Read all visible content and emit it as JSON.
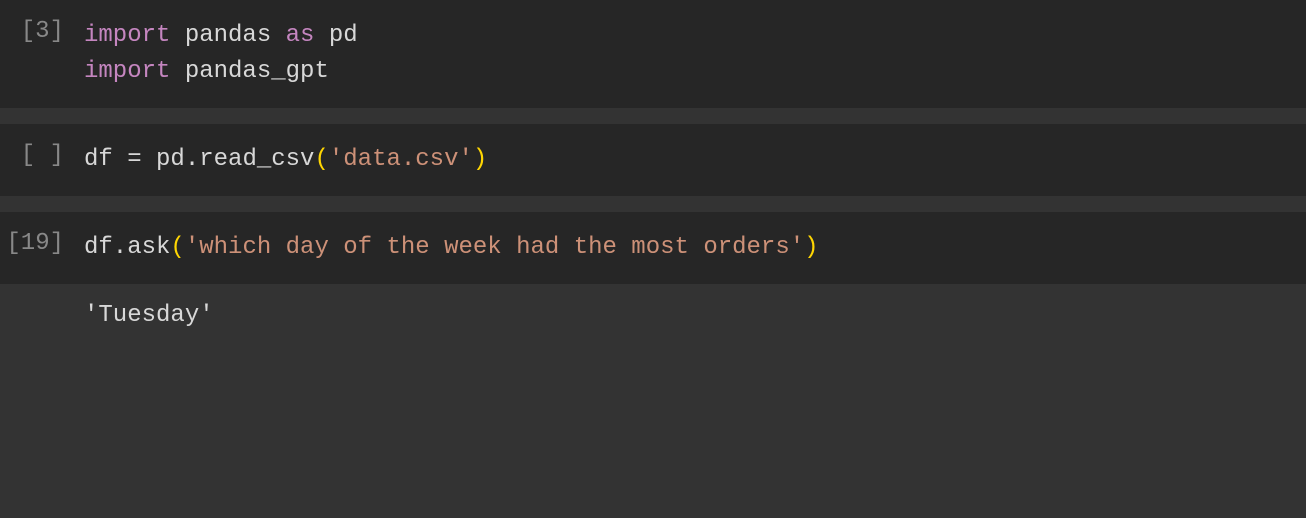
{
  "cells": {
    "c0": {
      "prompt": "[3]",
      "line1_kw1": "import",
      "line1_id1": " pandas ",
      "line1_kw2": "as",
      "line1_id2": " pd",
      "line2_kw1": "import",
      "line2_id1": " pandas_gpt"
    },
    "c1": {
      "prompt": "[ ]",
      "line1_id1": "df ",
      "line1_op": "=",
      "line1_id2": " pd.read_csv",
      "line1_paren_open": "(",
      "line1_str": "'data.csv'",
      "line1_paren_close": ")"
    },
    "c2": {
      "prompt": "[19]",
      "line1_id1": "df.ask",
      "line1_paren_open": "(",
      "line1_str": "'which day of the week had the most orders'",
      "line1_paren_close": ")",
      "output": "'Tuesday'"
    }
  }
}
